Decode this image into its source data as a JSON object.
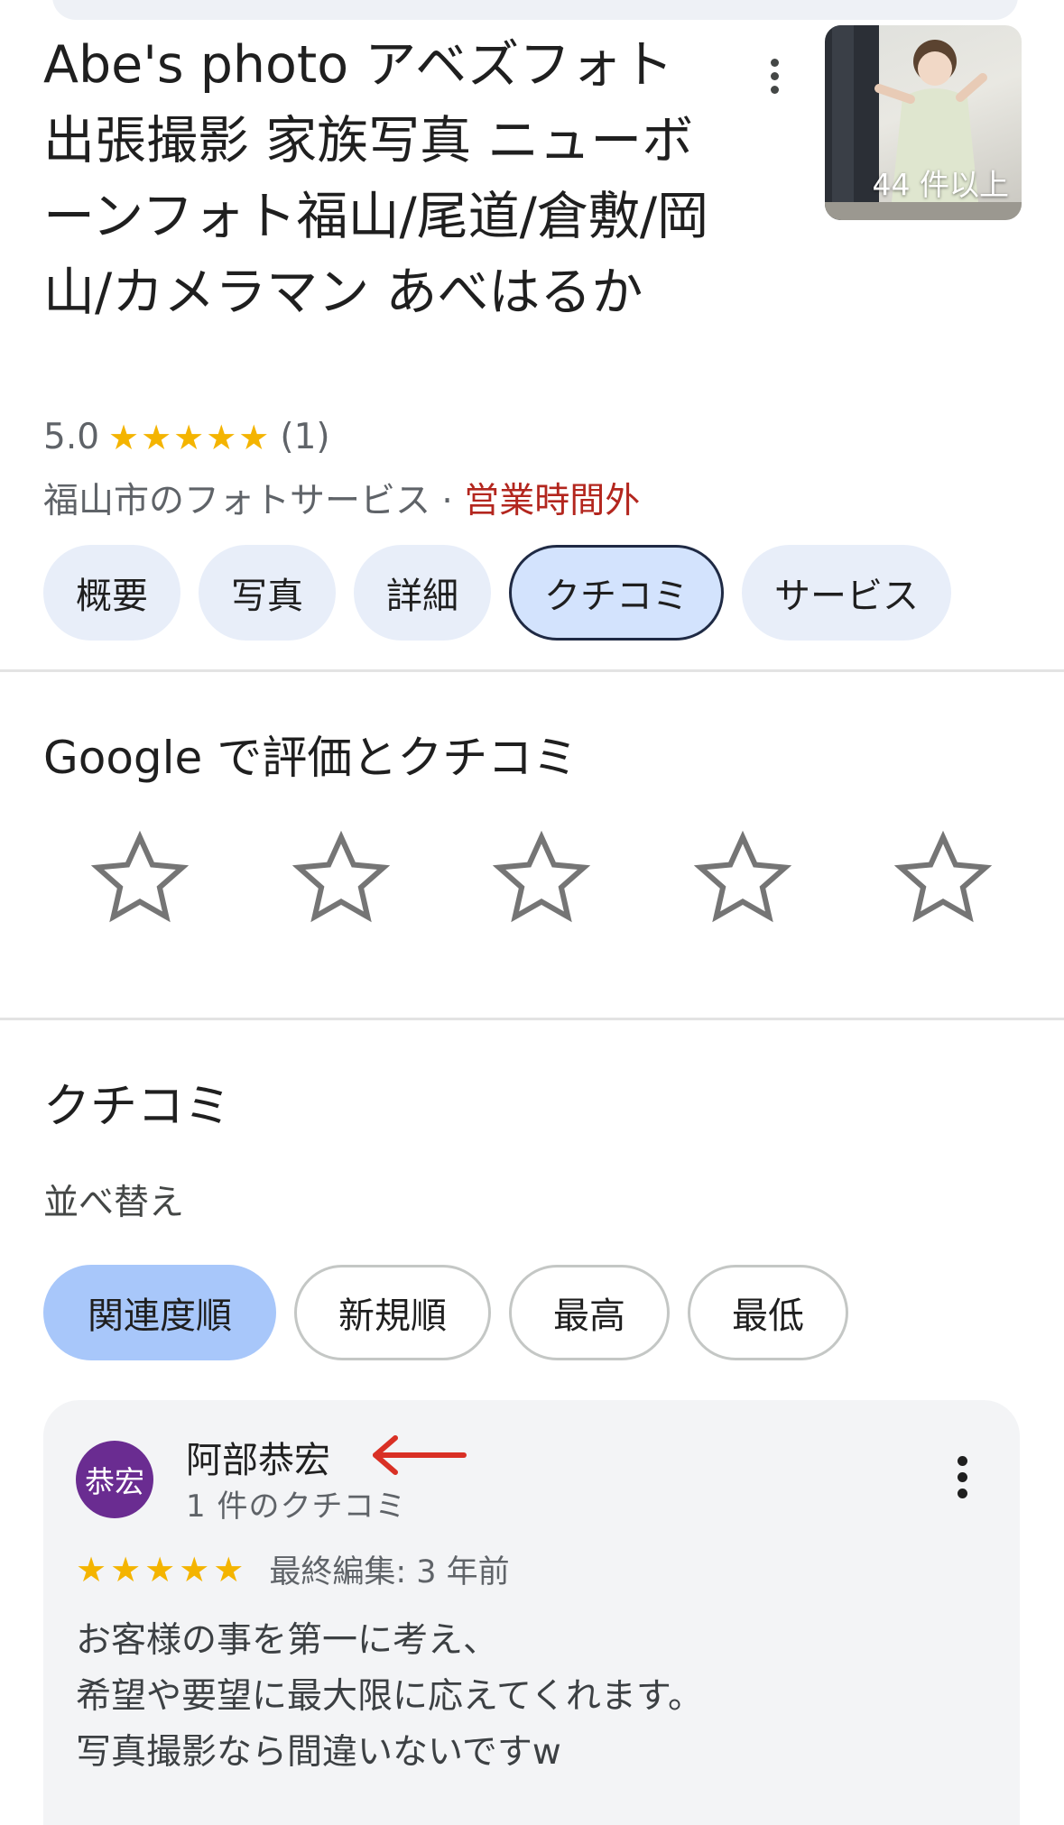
{
  "place": {
    "title": "Abe's photo アベズフォト 出張撮影 家族写真 ニューボーンフォト福山/尾道/倉敷/岡山/カメラマン あべはるか",
    "rating": "5.0",
    "stars": "★★★★★",
    "review_count": "(1)",
    "category": "福山市のフォトサービス",
    "separator": "·",
    "status": "営業時間外",
    "photo_count": "44 件以上"
  },
  "tabs": [
    {
      "label": "概要"
    },
    {
      "label": "写真"
    },
    {
      "label": "詳細"
    },
    {
      "label": "クチコミ",
      "active": true
    },
    {
      "label": "サービス"
    }
  ],
  "rate_section": {
    "title": "Google で評価とクチコミ"
  },
  "reviews_section": {
    "title": "クチコミ",
    "sort_label": "並べ替え",
    "sort_options": [
      {
        "label": "関連度順",
        "selected": true
      },
      {
        "label": "新規順"
      },
      {
        "label": "最高"
      },
      {
        "label": "最低"
      }
    ]
  },
  "review": {
    "avatar_text": "恭宏",
    "author": "阿部恭宏",
    "author_meta": "1 件のクチコミ",
    "stars": "★★★★★",
    "date": "最終編集: 3 年前",
    "lines": [
      "お客様の事を第一に考え、",
      "希望や要望に最大限に応えてくれます。",
      "写真撮影なら間違いないですw"
    ]
  },
  "colors": {
    "star": "#f4b400",
    "closed_status": "#b3261e",
    "chip_bg": "#e8eef9",
    "sort_selected": "#a8c7fa",
    "avatar": "#6a2c91",
    "arrow": "#d93025"
  },
  "icons": [
    "more-vert-icon",
    "star-outline-icon",
    "arrow-left-icon"
  ]
}
